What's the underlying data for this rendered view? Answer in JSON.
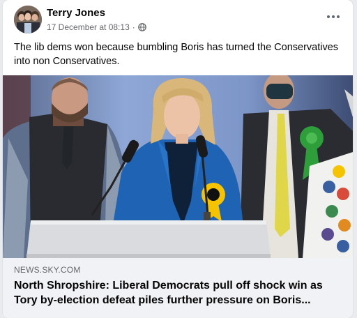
{
  "post": {
    "author": "Terry Jones",
    "timestamp": "17 December at 08:13",
    "separator": "·",
    "privacy_icon": "globe-icon",
    "more_icon": "more-options-icon",
    "text": "The lib dems won because bumbling Boris has turned the Conservatives into non Conservatives."
  },
  "link": {
    "domain": "NEWS.SKY.COM",
    "headline": "North Shropshire: Liberal Democrats pull off shock win as Tory by-election defeat piles further pressure on Boris..."
  },
  "colors": {
    "card_bg": "#ffffff",
    "page_bg": "#e9ebee",
    "preview_bg": "#f0f2f5",
    "text_primary": "#050505",
    "text_secondary": "#65676b",
    "lib_dem_yellow": "#f6c300",
    "green_party": "#2e9e3a",
    "blazer_blue": "#1f63b5"
  }
}
